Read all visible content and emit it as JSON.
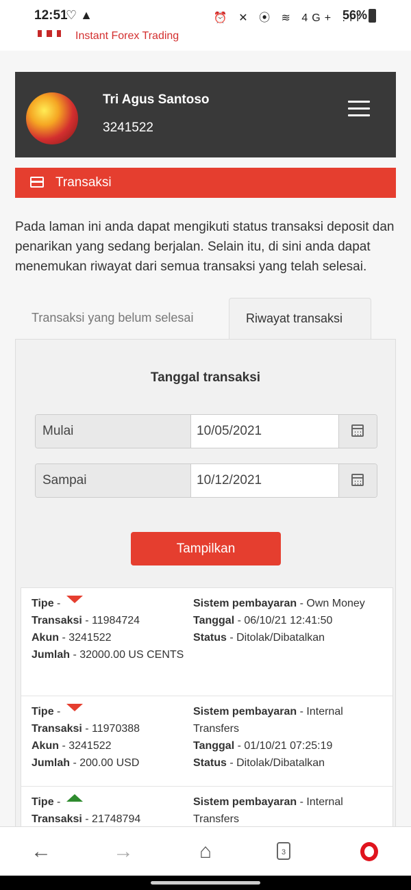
{
  "status_bar": {
    "time": "12:51",
    "left_icons": "♡ ▲",
    "right_icons": "⏰ ✕ ⦿ ≋ 4G+ .ıl",
    "battery": "56%"
  },
  "app_header": {
    "brand": "Instant Forex Trading",
    "brand_color": "#d32f2f"
  },
  "profile": {
    "name": "Tri Agus Santoso",
    "account": "3241522",
    "menu_icon": "hamburger-icon"
  },
  "section": {
    "title": "Transaksi",
    "icon": "credit-card-icon",
    "color": "#e53e2f"
  },
  "description": "Pada laman ini anda dapat mengikuti status transaksi deposit dan penarikan yang sedang berjalan. Selain itu, di sini anda dapat menemukan riwayat dari semua transaksi yang telah selesai.",
  "tabs": [
    {
      "label": "Transaksi yang belum selesai",
      "active": false
    },
    {
      "label": "Riwayat transaksi",
      "active": true
    }
  ],
  "filter": {
    "title": "Tanggal transaksi",
    "start_label": "Mulai",
    "start_value": "10/05/2021",
    "end_label": "Sampai",
    "end_value": "10/12/2021",
    "submit_label": "Tampilkan"
  },
  "transactions": [
    {
      "type_label": "Tipe",
      "type_icon": "down-arrow-red",
      "transaction_label": "Transaksi",
      "transaction": "11984724",
      "account_label": "Akun",
      "account": "3241522",
      "amount_label": "Jumlah",
      "amount": "32000.00 US CENTS",
      "payment_label": "Sistem pembayaran",
      "payment": "Own Money",
      "date_label": "Tanggal",
      "date": "06/10/21 12:41:50",
      "status_label": "Status",
      "status": "Ditolak/Dibatalkan"
    },
    {
      "type_label": "Tipe",
      "type_icon": "down-arrow-red",
      "transaction_label": "Transaksi",
      "transaction": "11970388",
      "account_label": "Akun",
      "account": "3241522",
      "amount_label": "Jumlah",
      "amount": "200.00 USD",
      "payment_label": "Sistem pembayaran",
      "payment": "Internal Transfers",
      "date_label": "Tanggal",
      "date": "01/10/21 07:25:19",
      "status_label": "Status",
      "status": "Ditolak/Dibatalkan"
    },
    {
      "type_label": "Tipe",
      "type_icon": "up-arrow-green",
      "transaction_label": "Transaksi",
      "transaction": "21748794",
      "payment_label": "Sistem pembayaran",
      "payment": "Internal Transfers"
    }
  ],
  "browser_nav": {
    "back_icon": "back-arrow-icon",
    "forward_icon": "forward-arrow-icon",
    "home_icon": "home-icon",
    "tabs_count": "3",
    "opera_icon": "opera-logo-icon"
  }
}
